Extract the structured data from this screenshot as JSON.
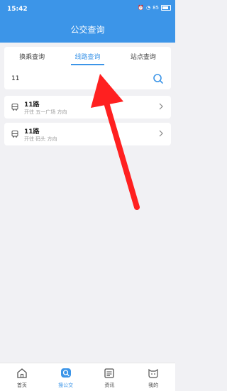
{
  "status": {
    "time": "15:42",
    "battery": "85"
  },
  "header": {
    "title": "公交查询"
  },
  "tabs": [
    {
      "label": "换乘查询"
    },
    {
      "label": "线路查询"
    },
    {
      "label": "站点查询"
    }
  ],
  "search": {
    "value": "11"
  },
  "results": [
    {
      "name": "11路",
      "subtitle": "开往 五一广场 方向"
    },
    {
      "name": "11路",
      "subtitle": "开往 码头 方向"
    }
  ],
  "nav": [
    {
      "label": "首页"
    },
    {
      "label": "搜公交"
    },
    {
      "label": "资讯"
    },
    {
      "label": "我的"
    }
  ],
  "colors": {
    "accent": "#3c95e8",
    "annotation_arrow": "#ff2020"
  }
}
